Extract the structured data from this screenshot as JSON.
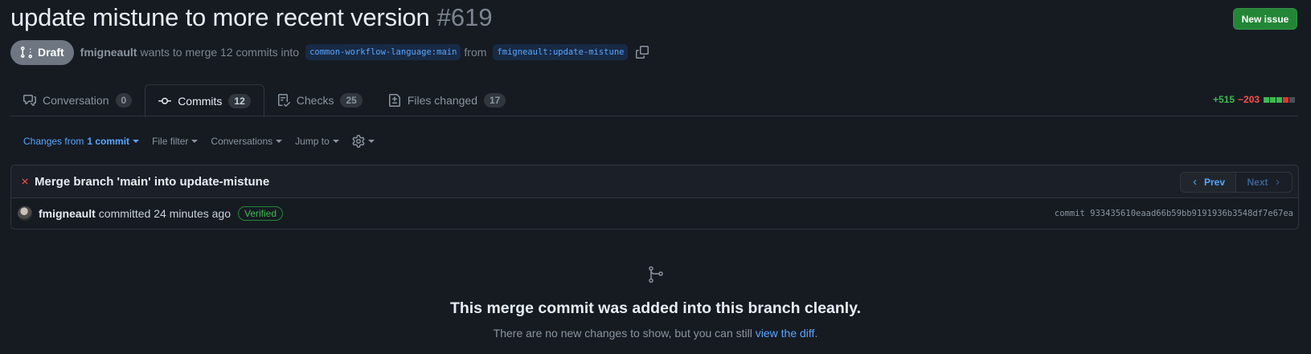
{
  "pr": {
    "title": "update mistune to more recent version",
    "number": "#619",
    "status": "Draft",
    "author": "fmigneault",
    "merge_text": "wants to merge 12 commits into",
    "base_branch": "common-workflow-language:main",
    "from_text": "from",
    "head_branch": "fmigneault:update-mistune"
  },
  "header": {
    "new_issue_label": "New issue"
  },
  "tabs": [
    {
      "label": "Conversation",
      "count": "0",
      "icon": "comment-discussion-icon"
    },
    {
      "label": "Commits",
      "count": "12",
      "icon": "git-commit-icon"
    },
    {
      "label": "Checks",
      "count": "25",
      "icon": "checklist-icon"
    },
    {
      "label": "Files changed",
      "count": "17",
      "icon": "file-diff-icon"
    }
  ],
  "diffstat": {
    "additions": "+515",
    "deletions": "−203",
    "blocks": [
      "#3fb950",
      "#3fb950",
      "#3fb950",
      "#da3633",
      "#484f58"
    ]
  },
  "toolbar": {
    "changes_prefix": "Changes from",
    "changes_value": "1 commit",
    "file_filter": "File filter",
    "conversations": "Conversations",
    "jump_to": "Jump to"
  },
  "commit": {
    "status": "failed",
    "title": "Merge branch 'main' into update-mistune",
    "prev_label": "Prev",
    "next_label": "Next",
    "author": "fmigneault",
    "committed_text": "committed 24 minutes ago",
    "verified_label": "Verified",
    "sha": "commit 933435610eaad66b59bb9191936b3548df7e67ea"
  },
  "empty_state": {
    "title": "This merge commit was added into this branch cleanly.",
    "subtitle_prefix": "There are no new changes to show, but you can still",
    "link_text": "view the diff",
    "subtitle_suffix": "."
  },
  "colors": {
    "background": "#161b22",
    "accent": "#58a6ff",
    "success": "#238636",
    "danger": "#f85149",
    "draft": "#6e7681"
  }
}
